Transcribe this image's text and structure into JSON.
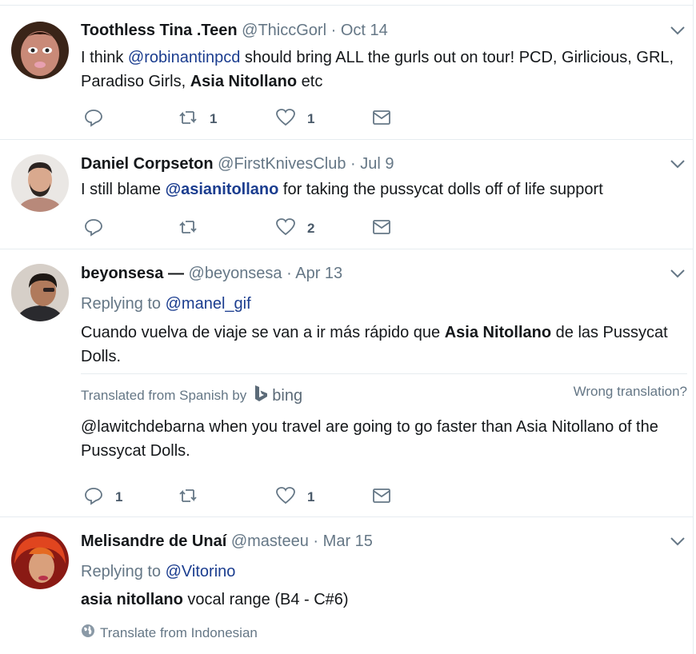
{
  "tweets": [
    {
      "name": "Toothless Tina .Teen",
      "handle": "@ThiccGorl",
      "dot": "·",
      "time": "Oct 14",
      "text_parts": {
        "p1": "I think ",
        "mention": "@robinantinpcd",
        "p2": " should bring ALL the gurls out on tour! PCD, Girlicious, GRL, Paradiso Girls, ",
        "bold": "Asia Nitollano",
        "p3": " etc"
      },
      "retweets": "1",
      "likes": "1"
    },
    {
      "name": "Daniel Corpseton",
      "handle": "@FirstKnivesClub",
      "dot": "·",
      "time": "Jul 9",
      "text_parts": {
        "p1": "I still blame ",
        "mention_bold": "@asianitollano",
        "p2": " for taking the pussycat dolls off of life support"
      },
      "likes": "2"
    },
    {
      "name": "beyonsesa —",
      "handle": "@beyonsesa",
      "dot": "·",
      "time": "Apr 13",
      "replying_label": "Replying to ",
      "replying_handle": "@manel_gif",
      "text_parts": {
        "p1": "Cuando vuelva de viaje se van a ir más rápido que ",
        "bold": "Asia Nitollano",
        "p2": " de las Pussycat Dolls."
      },
      "translated_from": "Translated from Spanish by",
      "bing_label": "bing",
      "wrong_translation": "Wrong translation?",
      "translation": "@lawitchdebarna when you travel are going to go faster than Asia Nitollano of the Pussycat Dolls.",
      "replies": "1",
      "likes": "1"
    },
    {
      "name": "Melisandre de Unaí",
      "handle": "@masteeu",
      "dot": "·",
      "time": "Mar 15",
      "replying_label": "Replying to ",
      "replying_handle": "@Vitorino",
      "text_parts": {
        "bold": "asia nitollano",
        "p1": " vocal range (B4 - C#6)"
      },
      "translate_link": "Translate from Indonesian"
    }
  ],
  "icons": {
    "reply": "reply-icon",
    "retweet": "retweet-icon",
    "like": "heart-icon",
    "dm": "envelope-icon",
    "caret": "chevron-down-icon",
    "globe": "globe-icon",
    "bing": "bing-logo-icon"
  },
  "colors": {
    "mention": "#1b3d8f",
    "muted": "#657786",
    "icon": "#657786",
    "divider": "#e6ecf0"
  }
}
